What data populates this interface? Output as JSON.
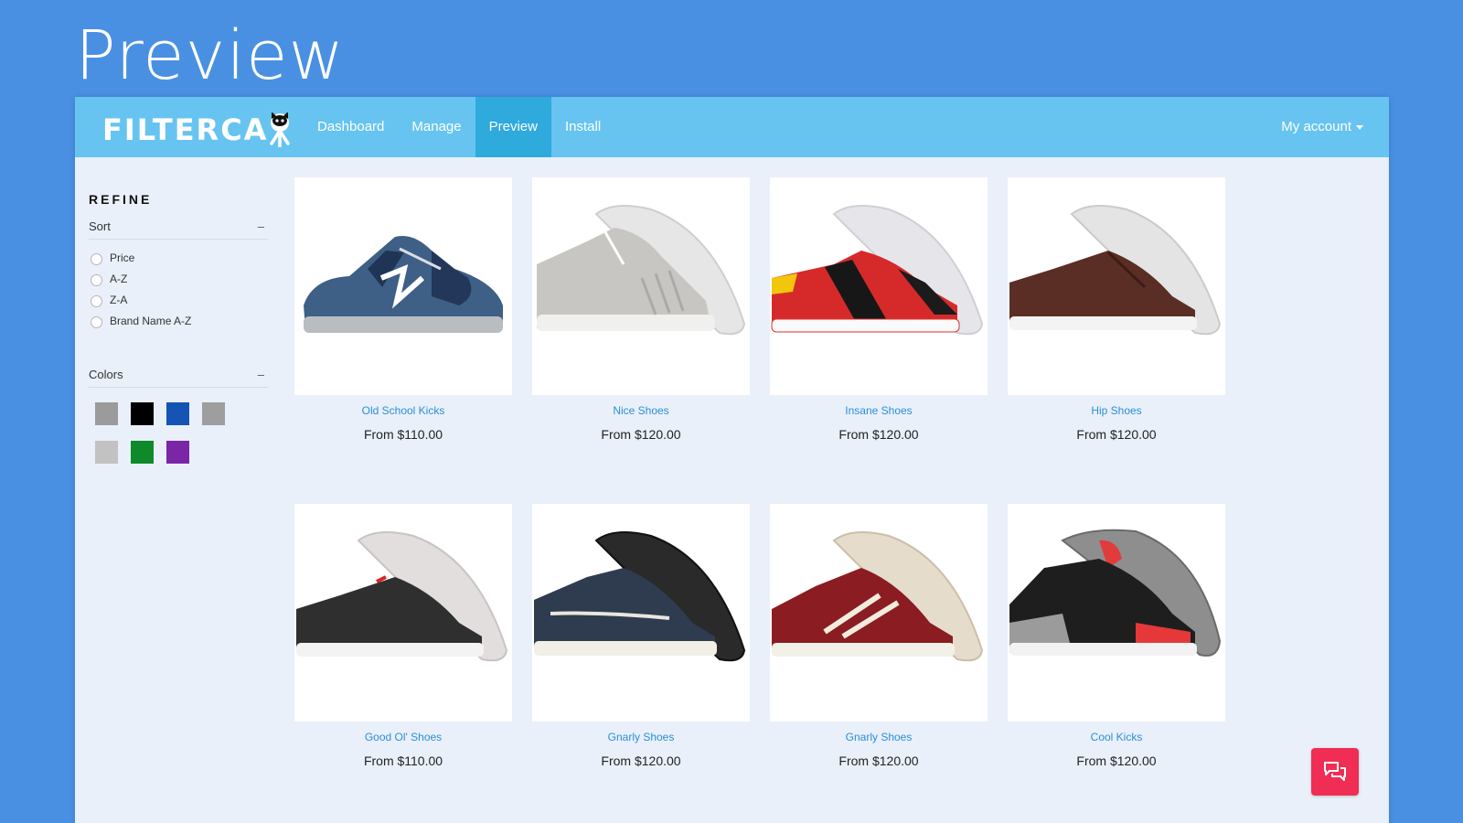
{
  "slide": {
    "title": "Preview"
  },
  "app": {
    "logo_text": "FILTERCA",
    "nav": [
      {
        "label": "Dashboard",
        "active": false
      },
      {
        "label": "Manage",
        "active": false
      },
      {
        "label": "Preview",
        "active": true
      },
      {
        "label": "Install",
        "active": false
      }
    ],
    "account_label": "My account"
  },
  "sidebar": {
    "heading": "REFINE",
    "sort": {
      "label": "Sort",
      "toggle": "–",
      "options": [
        "Price",
        "A-Z",
        "Z-A",
        "Brand Name A-Z"
      ]
    },
    "colors": {
      "label": "Colors",
      "toggle": "–",
      "swatches": [
        "#9b9b9b",
        "#000000",
        "#1554b4",
        "#9e9e9e",
        "#c2c2c2",
        "#0e8a2a",
        "#7a26a6"
      ]
    }
  },
  "products": [
    {
      "name": "Old School Kicks",
      "price": "From $110.00",
      "icon": "blue-running-shoe"
    },
    {
      "name": "Nice Shoes",
      "price": "From $120.00",
      "icon": "grey-high-top-shoe"
    },
    {
      "name": "Insane Shoes",
      "price": "From $120.00",
      "icon": "red-black-yellow-sneaker"
    },
    {
      "name": "Hip Shoes",
      "price": "From $120.00",
      "icon": "brown-leather-sneaker"
    },
    {
      "name": "Good Ol' Shoes",
      "price": "From $110.00",
      "icon": "black-leather-sneaker"
    },
    {
      "name": "Gnarly Shoes",
      "price": "From $120.00",
      "icon": "navy-boat-shoe"
    },
    {
      "name": "Gnarly Shoes",
      "price": "From $120.00",
      "icon": "maroon-high-top-shoe"
    },
    {
      "name": "Cool Kicks",
      "price": "From $120.00",
      "icon": "black-cement-basketball-shoe"
    }
  ],
  "colors": {
    "background": "#4a90e2",
    "navbar": "#67c4f1",
    "nav_active": "#2eaadd",
    "content_bg": "#e9f0fa",
    "link": "#2b8fd6",
    "chat": "#f02e55"
  }
}
